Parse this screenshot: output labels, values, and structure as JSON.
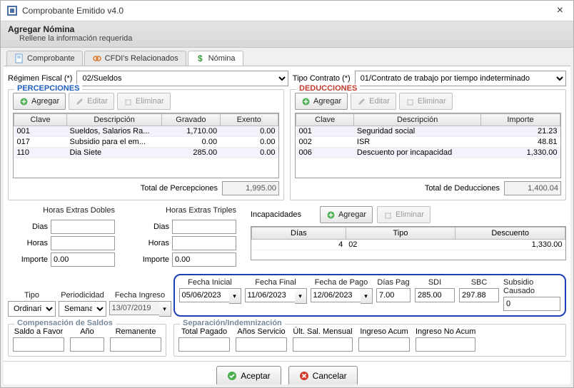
{
  "window": {
    "title": "Comprobante Emitido v4.0",
    "close": "×"
  },
  "header": {
    "title": "Agregar Nómina",
    "subtitle": "Rellene la información requerida"
  },
  "tabs": [
    {
      "label": "Comprobante",
      "active": false
    },
    {
      "label": "CFDI's Relacionados",
      "active": false
    },
    {
      "label": "Nómina",
      "active": true
    }
  ],
  "topRow": {
    "regimenLabel": "Régimen Fiscal (*)",
    "regimenValue": "02/Sueldos",
    "tipoContratoLabel": "Tipo Contrato (*)",
    "tipoContratoValue": "01/Contrato de trabajo por tiempo indeterminado"
  },
  "percepciones": {
    "legend": "PERCEPCIONES",
    "btnAdd": "Agregar",
    "btnEdit": "Editar",
    "btnDel": "Eliminar",
    "headers": {
      "clave": "Clave",
      "desc": "Descripción",
      "gravado": "Gravado",
      "exento": "Exento"
    },
    "rows": [
      {
        "clave": "001",
        "desc": "Sueldos, Salarios  Ra...",
        "gravado": "1,710.00",
        "exento": "0.00"
      },
      {
        "clave": "017",
        "desc": "Subsidio para el em...",
        "gravado": "0.00",
        "exento": "0.00"
      },
      {
        "clave": "110",
        "desc": "Dia Siete",
        "gravado": "285.00",
        "exento": "0.00"
      }
    ],
    "totalLabel": "Total de Percepciones",
    "totalValue": "1,995.00"
  },
  "deducciones": {
    "legend": "DEDUCCIONES",
    "btnAdd": "Agregar",
    "btnEdit": "Editar",
    "btnDel": "Eliminar",
    "headers": {
      "clave": "Clave",
      "desc": "Descripción",
      "importe": "Importe"
    },
    "rows": [
      {
        "clave": "001",
        "desc": "Seguridad social",
        "importe": "21.23"
      },
      {
        "clave": "002",
        "desc": "ISR",
        "importe": "48.81"
      },
      {
        "clave": "006",
        "desc": "Descuento por incapacidad",
        "importe": "1,330.00"
      }
    ],
    "totalLabel": "Total de Deducciones",
    "totalValue": "1,400.04"
  },
  "horas": {
    "doblesTitle": "Horas Extras Dobles",
    "triplesTitle": "Horas Extras Triples",
    "dias": "Dias",
    "horasLbl": "Horas",
    "importe": "Importe",
    "dobles": {
      "dias": "",
      "horas": "",
      "importe": "0.00"
    },
    "triples": {
      "dias": "",
      "horas": "",
      "importe": "0.00"
    }
  },
  "incapacidades": {
    "label": "Incapacidades",
    "btnAdd": "Agregar",
    "btnDel": "Eliminar",
    "headers": {
      "dias": "Días",
      "tipo": "Tipo",
      "desc": "Descuento"
    },
    "rows": [
      {
        "dias": "4",
        "tipo": "02",
        "desc": "1,330.00"
      }
    ]
  },
  "periodo": {
    "tipo": "Tipo",
    "tipoVal": "Ordinaria",
    "period": "Periodicidad",
    "periodVal": "Semanal",
    "fechaIngreso": "Fecha Ingreso",
    "fechaIngresoVal": "13/07/2019",
    "fechaInicial": "Fecha Inicial",
    "fechaInicialVal": "05/06/2023",
    "fechaFinal": "Fecha Final",
    "fechaFinalVal": "11/06/2023",
    "fechaPago": "Fecha de Pago",
    "fechaPagoVal": "12/06/2023",
    "diasPag": "Días Pag",
    "diasPagVal": "7.00",
    "sdi": "SDI",
    "sdiVal": "285.00",
    "sbc": "SBC",
    "sbcVal": "297.88",
    "subsidio": "Subsidio Causado",
    "subsidioVal": "0"
  },
  "compSaldos": {
    "legend": "Compensación de Saldos",
    "saldoFavor": "Saldo a Favor",
    "ano": "Año",
    "remanente": "Remanente"
  },
  "sepIndem": {
    "legend": "Separación/Indemnización",
    "totalPagado": "Total Pagado",
    "anosServicio": "Años Servicio",
    "ultSal": "Últ. Sal. Mensual",
    "ingresoAcum": "Ingreso Acum",
    "ingresoNoAcum": "Ingreso No Acum"
  },
  "dialog": {
    "accept": "Aceptar",
    "cancel": "Cancelar"
  }
}
